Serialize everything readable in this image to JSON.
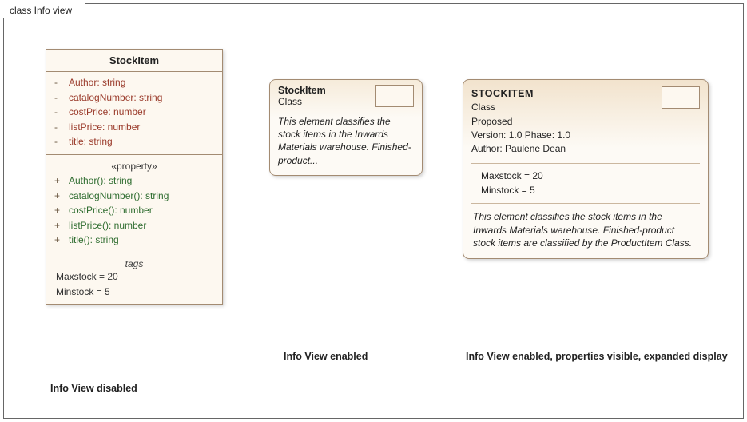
{
  "frame": {
    "title": "class Info view"
  },
  "uml": {
    "name": "StockItem",
    "attributes": [
      {
        "vis": "-",
        "text": "Author: string"
      },
      {
        "vis": "-",
        "text": "catalogNumber: string"
      },
      {
        "vis": "-",
        "text": "costPrice: number"
      },
      {
        "vis": "-",
        "text": "listPrice: number"
      },
      {
        "vis": "-",
        "text": "title: string"
      }
    ],
    "stereotype": "«property»",
    "operations": [
      {
        "vis": "+",
        "text": "Author(): string"
      },
      {
        "vis": "+",
        "text": "catalogNumber(): string"
      },
      {
        "vis": "+",
        "text": "costPrice(): number"
      },
      {
        "vis": "+",
        "text": "listPrice(): number"
      },
      {
        "vis": "+",
        "text": "title(): string"
      }
    ],
    "tagsHeading": "tags",
    "tags": [
      "Maxstock = 20",
      "Minstock = 5"
    ]
  },
  "infoSmall": {
    "name": "StockItem",
    "type": "Class",
    "desc": "This element classifies the stock items in the Inwards Materials warehouse. Finished-product..."
  },
  "infoXL": {
    "name": "STOCKITEM",
    "type": "Class",
    "status": "Proposed",
    "version": "Version: 1.0 Phase: 1.0",
    "author": "Author: Paulene Dean",
    "tags": [
      "Maxstock = 20",
      "Minstock = 5"
    ],
    "desc": "This element classifies the stock items in the Inwards Materials warehouse. Finished-product stock items are classified by the ProductItem Class."
  },
  "captions": {
    "disabled": "Info View disabled",
    "enabled": "Info View enabled",
    "expanded": "Info View enabled, properties visible, expanded display"
  }
}
